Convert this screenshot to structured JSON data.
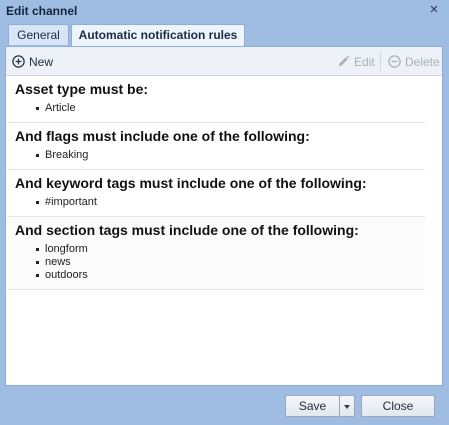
{
  "dialog": {
    "title": "Edit channel",
    "close_glyph": "×"
  },
  "tabs": [
    {
      "label": "General",
      "active": false
    },
    {
      "label": "Automatic notification rules",
      "active": true
    }
  ],
  "toolbar": {
    "new_label": "New",
    "edit_label": "Edit",
    "delete_label": "Delete",
    "new_icon": "plus-circle-icon",
    "edit_icon": "pencil-icon",
    "delete_icon": "minus-circle-icon"
  },
  "rules": [
    {
      "heading": "Asset type must be:",
      "items": [
        "Article"
      ]
    },
    {
      "heading": "And flags must include one of the following:",
      "items": [
        "Breaking"
      ]
    },
    {
      "heading": "And keyword tags must include one of the following:",
      "items": [
        "#important"
      ]
    },
    {
      "heading": "And section tags must include one of the following:",
      "items": [
        "longform",
        "news",
        "outdoors"
      ]
    }
  ],
  "footer": {
    "save_label": "Save",
    "close_label": "Close"
  },
  "colors": {
    "background": "#9fbde3",
    "panel": "#ffffff",
    "toolbar": "#eef2f8",
    "disabled_text": "#a8b0bb"
  }
}
